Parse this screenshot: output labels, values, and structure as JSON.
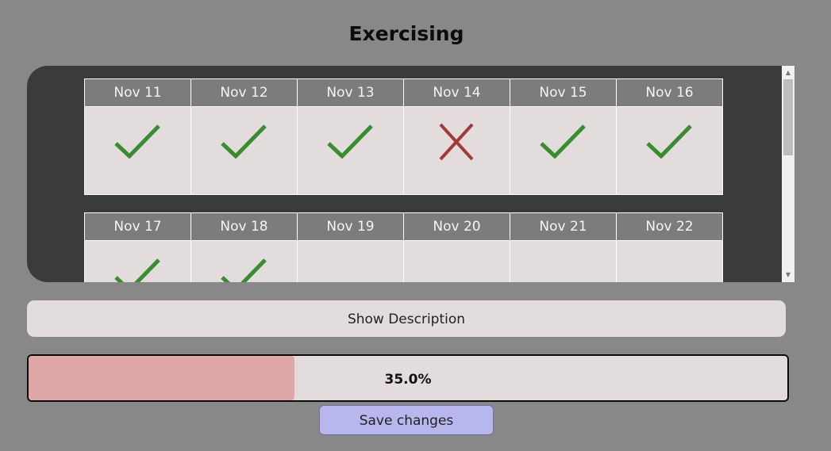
{
  "page": {
    "title": "Exercising"
  },
  "weeks": [
    {
      "days": [
        {
          "label": "Nov 11",
          "status": "done"
        },
        {
          "label": "Nov 12",
          "status": "done"
        },
        {
          "label": "Nov 13",
          "status": "done"
        },
        {
          "label": "Nov 14",
          "status": "missed"
        },
        {
          "label": "Nov 15",
          "status": "done"
        },
        {
          "label": "Nov 16",
          "status": "done"
        }
      ]
    },
    {
      "days": [
        {
          "label": "Nov 17",
          "status": "done"
        },
        {
          "label": "Nov 18",
          "status": "done"
        },
        {
          "label": "Nov 19",
          "status": "empty"
        },
        {
          "label": "Nov 20",
          "status": "empty"
        },
        {
          "label": "Nov 21",
          "status": "empty"
        },
        {
          "label": "Nov 22",
          "status": "empty"
        }
      ]
    }
  ],
  "description_button": {
    "label": "Show Description"
  },
  "progress": {
    "value": 0.35,
    "label": "35.0%"
  },
  "save_button": {
    "label": "Save changes"
  },
  "colors": {
    "check": "#3a8d2f",
    "cross": "#a23a3a",
    "progress_fill": "#e0a7a7"
  },
  "icons": {
    "done": "check-icon",
    "missed": "cross-icon"
  }
}
